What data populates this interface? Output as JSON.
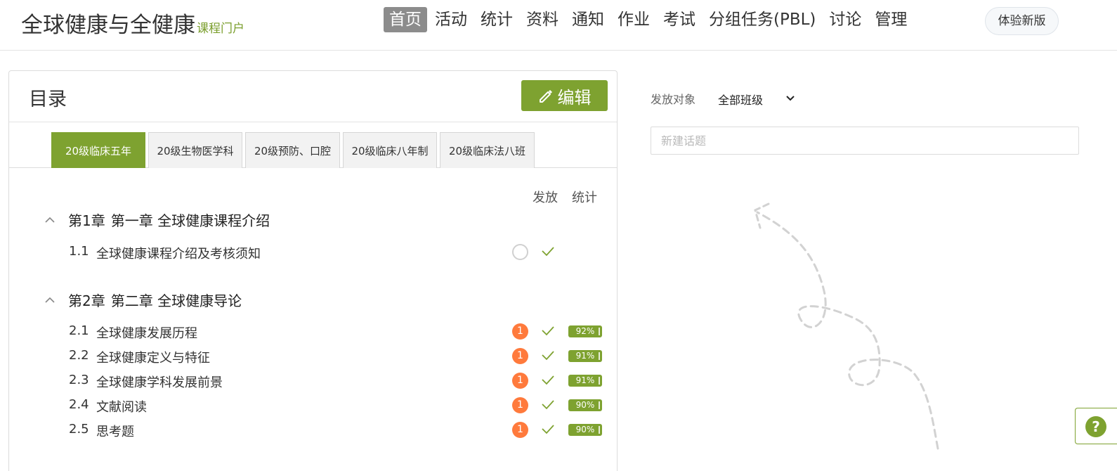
{
  "header": {
    "logo_main": "全球健康与全健康",
    "logo_sub": "课程门户",
    "nav": [
      {
        "label": "首页",
        "active": true
      },
      {
        "label": "活动"
      },
      {
        "label": "统计"
      },
      {
        "label": "资料"
      },
      {
        "label": "通知"
      },
      {
        "label": "作业"
      },
      {
        "label": "考试"
      },
      {
        "label": "分组任务(PBL)"
      },
      {
        "label": "讨论"
      },
      {
        "label": "管理"
      }
    ],
    "new_version": "体验新版"
  },
  "catalog": {
    "title": "目录",
    "edit_label": "编辑",
    "tabs": [
      {
        "label": "20级临床五年",
        "active": true
      },
      {
        "label": "20级生物医学科"
      },
      {
        "label": "20级预防、口腔"
      },
      {
        "label": "20级临床八年制"
      },
      {
        "label": "20级临床法八班"
      }
    ],
    "col_publish": "发放",
    "col_stats": "统计",
    "chapters": [
      {
        "num": "第1章",
        "title": "第一章 全球健康课程介绍",
        "lessons": [
          {
            "num": "1.1",
            "title": "全球健康课程介绍及考核须知",
            "publish": "",
            "published": false,
            "stats": ""
          }
        ]
      },
      {
        "num": "第2章",
        "title": "第二章 全球健康导论",
        "lessons": [
          {
            "num": "2.1",
            "title": "全球健康发展历程",
            "publish": "1",
            "published": true,
            "stats": "92%"
          },
          {
            "num": "2.2",
            "title": "全球健康定义与特征",
            "publish": "1",
            "published": true,
            "stats": "91%"
          },
          {
            "num": "2.3",
            "title": "全球健康学科发展前景",
            "publish": "1",
            "published": true,
            "stats": "91%"
          },
          {
            "num": "2.4",
            "title": "文献阅读",
            "publish": "1",
            "published": true,
            "stats": "90%"
          },
          {
            "num": "2.5",
            "title": "思考题",
            "publish": "1",
            "published": true,
            "stats": "90%"
          }
        ]
      }
    ]
  },
  "discussion": {
    "target_label": "发放对象",
    "target_value": "全部班级",
    "new_topic_placeholder": "新建话题"
  },
  "help": {
    "symbol": "?"
  },
  "colors": {
    "accent": "#7ea230",
    "badge": "#ff7a3c",
    "nav_active": "#8c8c8c"
  }
}
